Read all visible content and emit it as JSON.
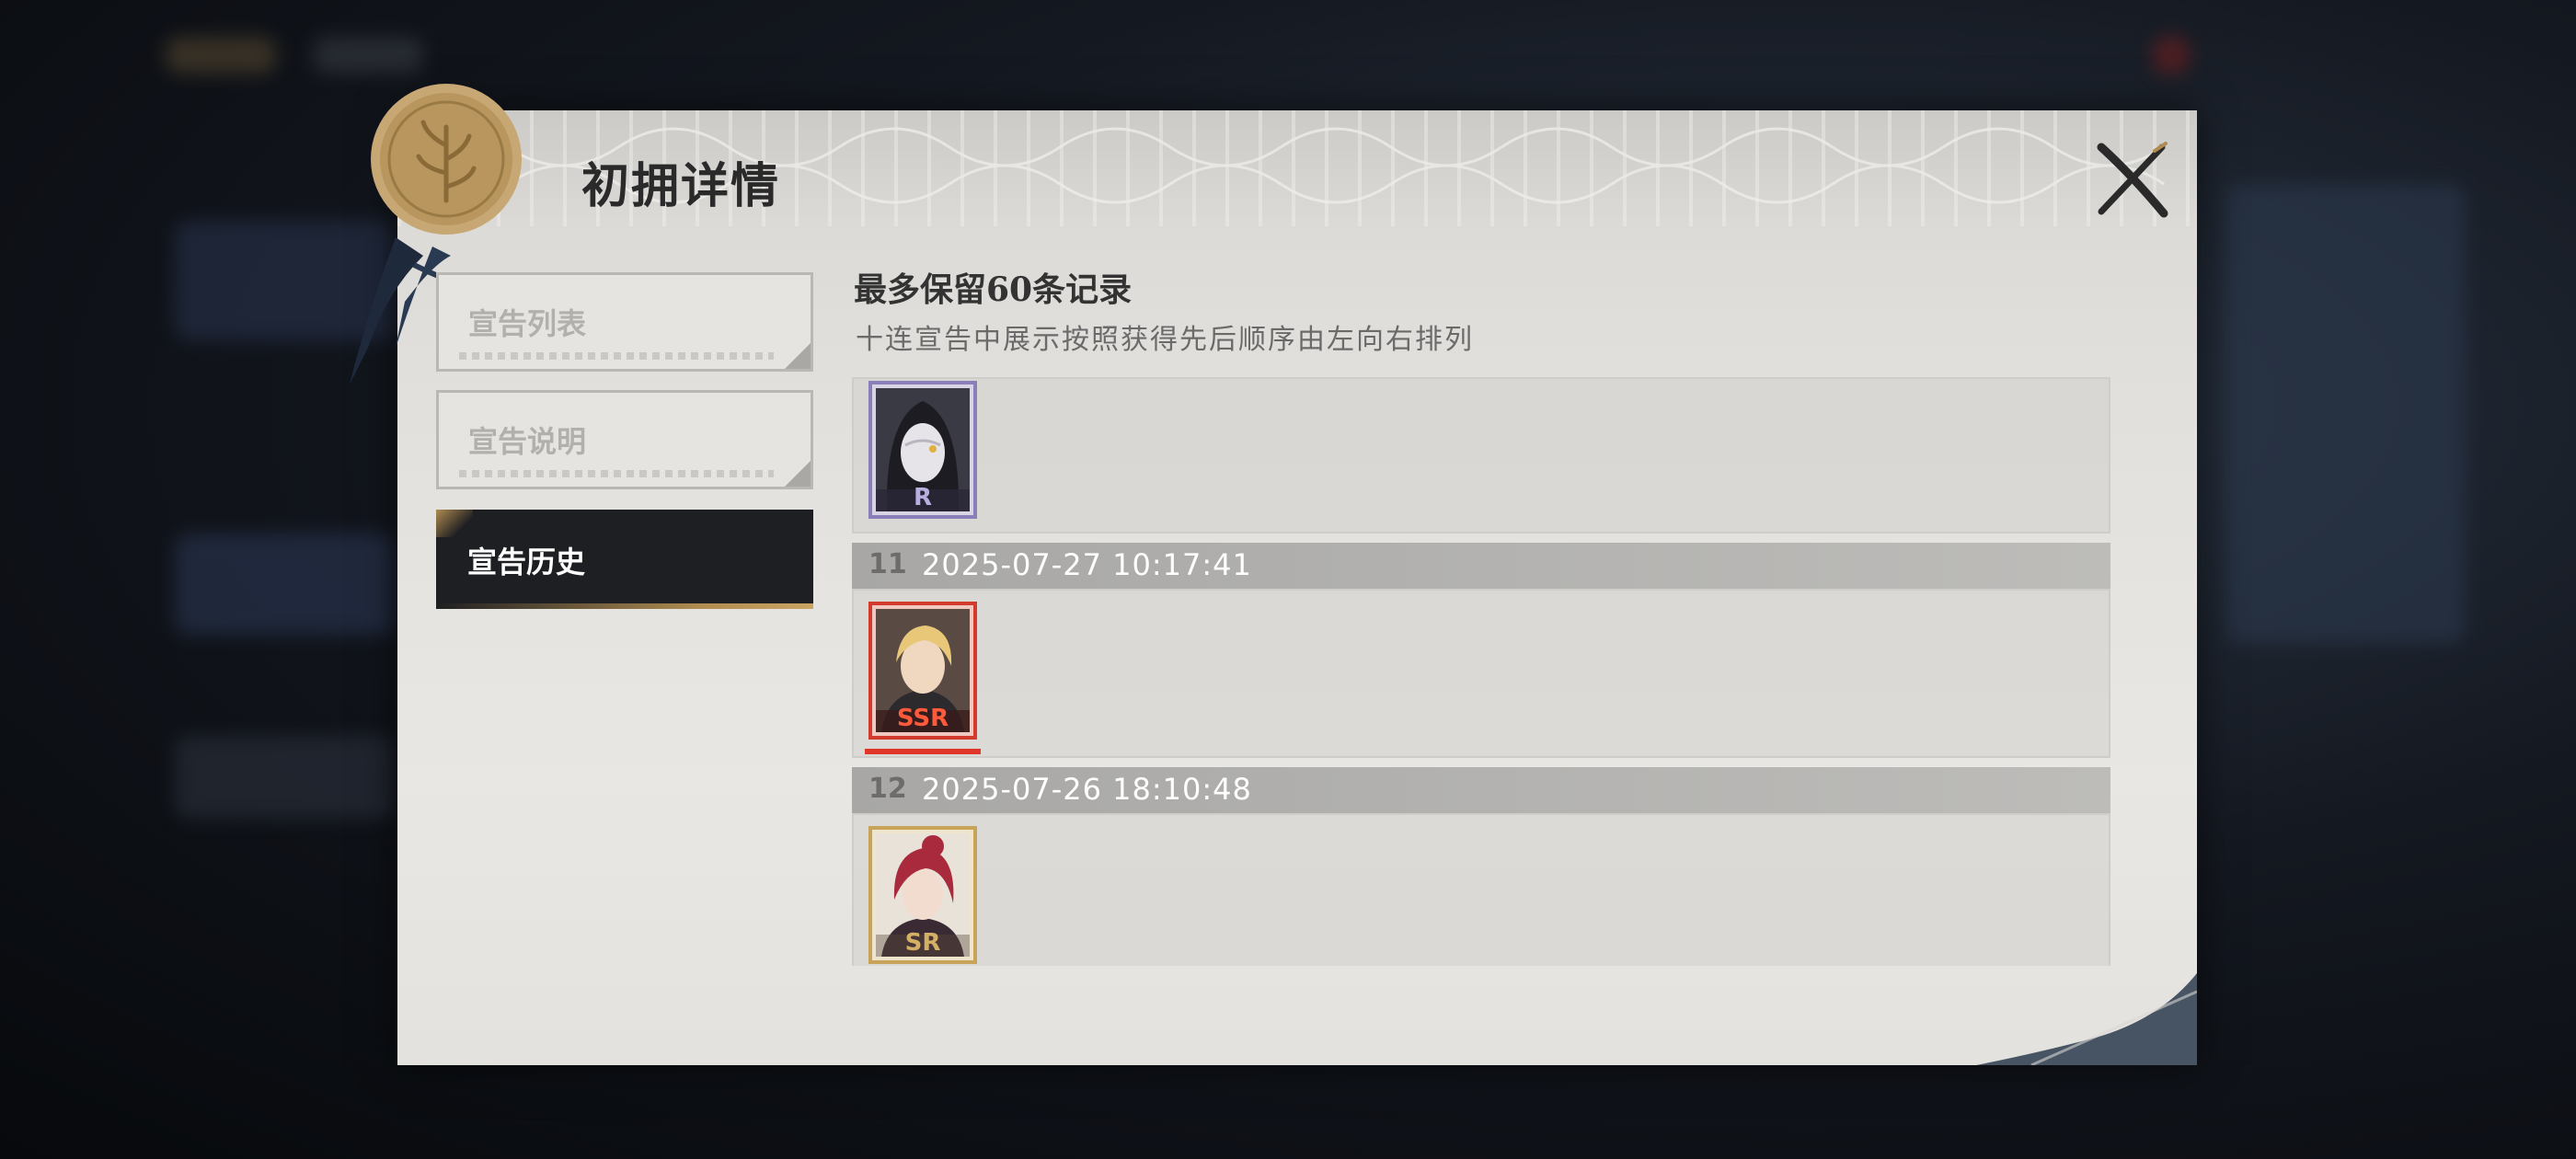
{
  "modal": {
    "title": "初拥详情",
    "close_icon": "close-x-icon",
    "seal_icon": "wax-seal-icon"
  },
  "tabs": [
    {
      "label": "宣告列表",
      "active": false
    },
    {
      "label": "宣告说明",
      "active": false
    },
    {
      "label": "宣告历史",
      "active": true
    }
  ],
  "history": {
    "title": "最多保留60条记录",
    "subtitle": "十连宣告中展示按照获得先后顺序由左向右排列",
    "records": [
      {
        "number": "",
        "time": "",
        "cards": [
          {
            "rarity": "R",
            "color": "#8a7fb8",
            "portrait": "hooded-masked-figure"
          }
        ]
      },
      {
        "number": "11",
        "time": "2025-07-27 10:17:41",
        "cards": [
          {
            "rarity": "SSR",
            "color": "#d23a2e",
            "portrait": "blond-man"
          }
        ]
      },
      {
        "number": "12",
        "time": "2025-07-26 18:10:48",
        "cards": [
          {
            "rarity": "SR",
            "color": "#c8a45a",
            "portrait": "red-haired-woman"
          }
        ]
      }
    ]
  },
  "colors": {
    "panel_bg": "#e4e2de",
    "active_tab": "#1e1f22",
    "gold_accent": "#b08c50",
    "ssr": "#d23a2e",
    "sr": "#c8a45a",
    "r": "#8a7fb8"
  }
}
